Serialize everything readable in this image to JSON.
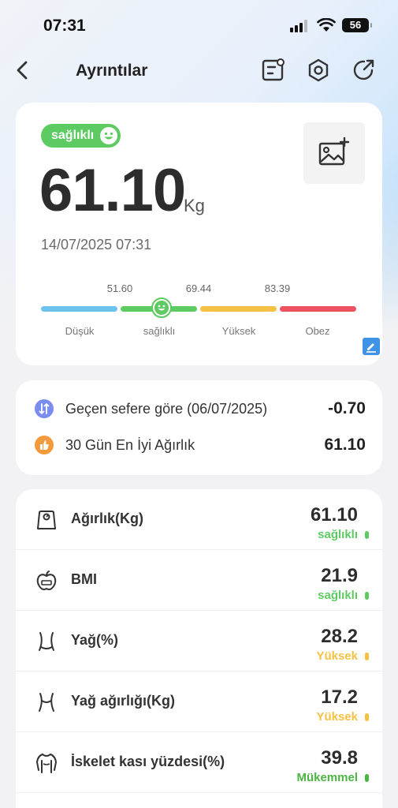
{
  "status_bar": {
    "time": "07:31",
    "battery": "56"
  },
  "nav": {
    "title": "Ayrıntılar"
  },
  "summary": {
    "badge": "sağlıklı",
    "weight": "61.10",
    "unit": "Kg",
    "datetime": "14/07/2025 07:31",
    "scale": {
      "ticks": [
        "51.60",
        "69.44",
        "83.39"
      ],
      "segments": [
        {
          "label": "Düşük",
          "color": "#6cc3ee"
        },
        {
          "label": "sağlıklı",
          "color": "#5dca62"
        },
        {
          "label": "Yüksek",
          "color": "#f5c142"
        },
        {
          "label": "Obez",
          "color": "#ee5160"
        }
      ]
    }
  },
  "comparison": [
    {
      "label": "Geçen sefere göre (06/07/2025)",
      "value": "-0.70",
      "icon": "compare-icon",
      "color": "#7b8cf0"
    },
    {
      "label": "30 Gün En İyi Ağırlık",
      "value": "61.10",
      "icon": "thumb-up-icon",
      "color": "#f59a3c"
    }
  ],
  "metrics": [
    {
      "label": "Ağırlık(Kg)",
      "value": "61.10",
      "status": "sağlıklı",
      "color": "#5dca62",
      "icon": "scale-icon"
    },
    {
      "label": "BMI",
      "value": "21.9",
      "status": "sağlıklı",
      "color": "#5dca62",
      "icon": "apple-icon"
    },
    {
      "label": "Yağ(%)",
      "value": "28.2",
      "status": "Yüksek",
      "color": "#f5c142",
      "icon": "waist-icon"
    },
    {
      "label": "Yağ ağırlığı(Kg)",
      "value": "17.2",
      "status": "Yüksek",
      "color": "#f5c142",
      "icon": "body-fat-icon"
    },
    {
      "label": "İskelet kası yüzdesi(%)",
      "value": "39.8",
      "status": "Mükemmel",
      "color": "#4bb541",
      "icon": "muscle-icon"
    }
  ]
}
